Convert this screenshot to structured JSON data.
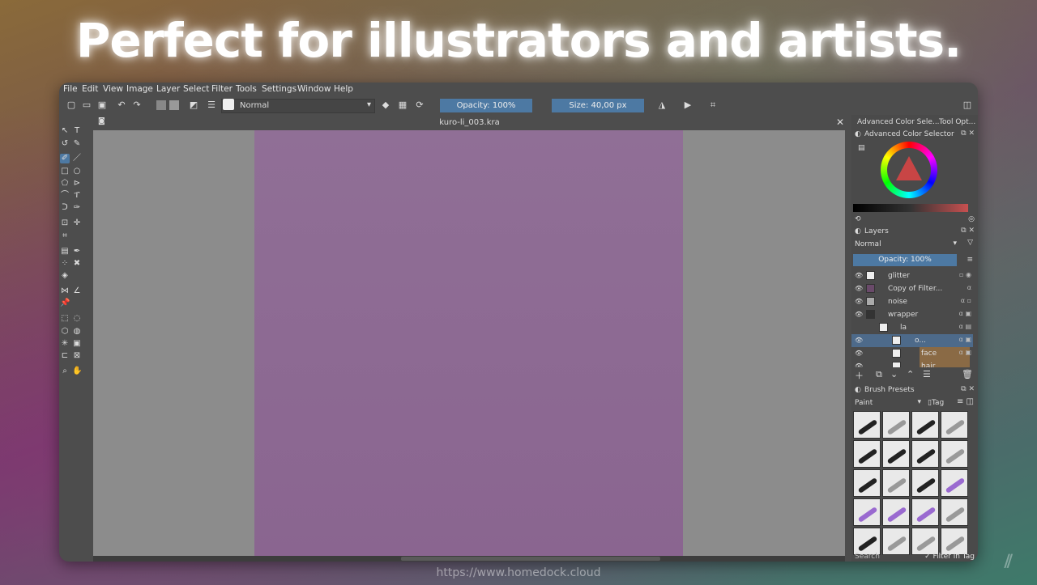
{
  "headline": "Perfect for illustrators and artists.",
  "menu": [
    "File",
    "Edit",
    "View",
    "Image",
    "Layer",
    "Select",
    "Filter",
    "Tools",
    "Settings",
    "Window",
    "Help"
  ],
  "toolbar": {
    "blend_mode": "Normal",
    "opacity": "Opacity: 100%",
    "size": "Size: 40,00 px"
  },
  "document": {
    "tab_title": "kuro-li_003.kra",
    "paper_color": "#8c6893",
    "canvas_bg": "#8c8c8c"
  },
  "dock": {
    "tab_color_selector": "Advanced Color Sele...",
    "tab_tool_options": "Tool Opt...",
    "color_selector_title": "Advanced Color Selector",
    "layers_title": "Layers",
    "layer_blend": "Normal",
    "layer_opacity": "Opacity:  100%",
    "layers": [
      {
        "name": "glitter",
        "selected": false
      },
      {
        "name": "Copy of Filter...",
        "selected": false
      },
      {
        "name": "noise",
        "selected": false
      },
      {
        "name": "wrapper",
        "selected": false
      },
      {
        "name": "la",
        "selected": false
      },
      {
        "name": "o...",
        "selected": true
      },
      {
        "name": "face",
        "selected": false
      },
      {
        "name": "hair",
        "selected": false
      }
    ],
    "brush_presets_title": "Brush Presets",
    "preset_tag": "Paint",
    "tag_label": "Tag",
    "search_label": "Search",
    "filter_in_tag": "Filter in Tag"
  },
  "watermark": "https://www.homedock.cloud",
  "colors": {
    "accent": "#4d79a3",
    "panel": "#4a4a4a",
    "window": "#4d4d4d"
  }
}
